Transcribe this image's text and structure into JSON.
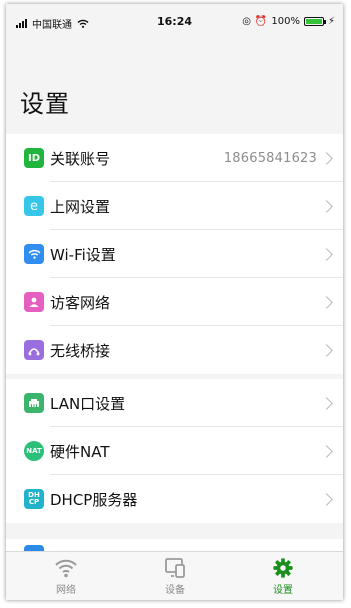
{
  "status_bar": {
    "carrier": "中国联通",
    "time": "16:24",
    "battery_percent": "100%",
    "battery_level": 1.0
  },
  "page": {
    "title": "设置"
  },
  "groups": [
    {
      "items": [
        {
          "label": "关联账号",
          "value": "18665841623",
          "icon": "account-id-icon",
          "icon_text": "ID",
          "color": "#20b53c"
        },
        {
          "label": "上网设置",
          "icon": "internet-icon",
          "icon_text": "e",
          "color": "#36c6e8"
        },
        {
          "label": "Wi-Fi设置",
          "icon": "wifi-icon",
          "color": "#2f8ef0"
        },
        {
          "label": "访客网络",
          "icon": "guest-icon",
          "color": "#e45fbf"
        },
        {
          "label": "无线桥接",
          "icon": "bridge-icon",
          "color": "#9b6ee0"
        }
      ]
    },
    {
      "items": [
        {
          "label": "LAN口设置",
          "icon": "lan-port-icon",
          "color": "#3bb56b"
        },
        {
          "label": "硬件NAT",
          "icon": "nat-icon",
          "icon_text": "NAT",
          "color": "#2cbf7a"
        },
        {
          "label": "DHCP服务器",
          "icon": "dhcp-icon",
          "icon_text": "DH\nCP",
          "color": "#20b3c9"
        }
      ]
    }
  ],
  "tabbar": {
    "tabs": [
      {
        "label": "网络",
        "icon": "network-icon",
        "active": false
      },
      {
        "label": "设备",
        "icon": "devices-icon",
        "active": false
      },
      {
        "label": "设置",
        "icon": "gear-icon",
        "active": true
      }
    ],
    "active_color": "#1b8f1b",
    "inactive_color": "#8a8a8a"
  }
}
